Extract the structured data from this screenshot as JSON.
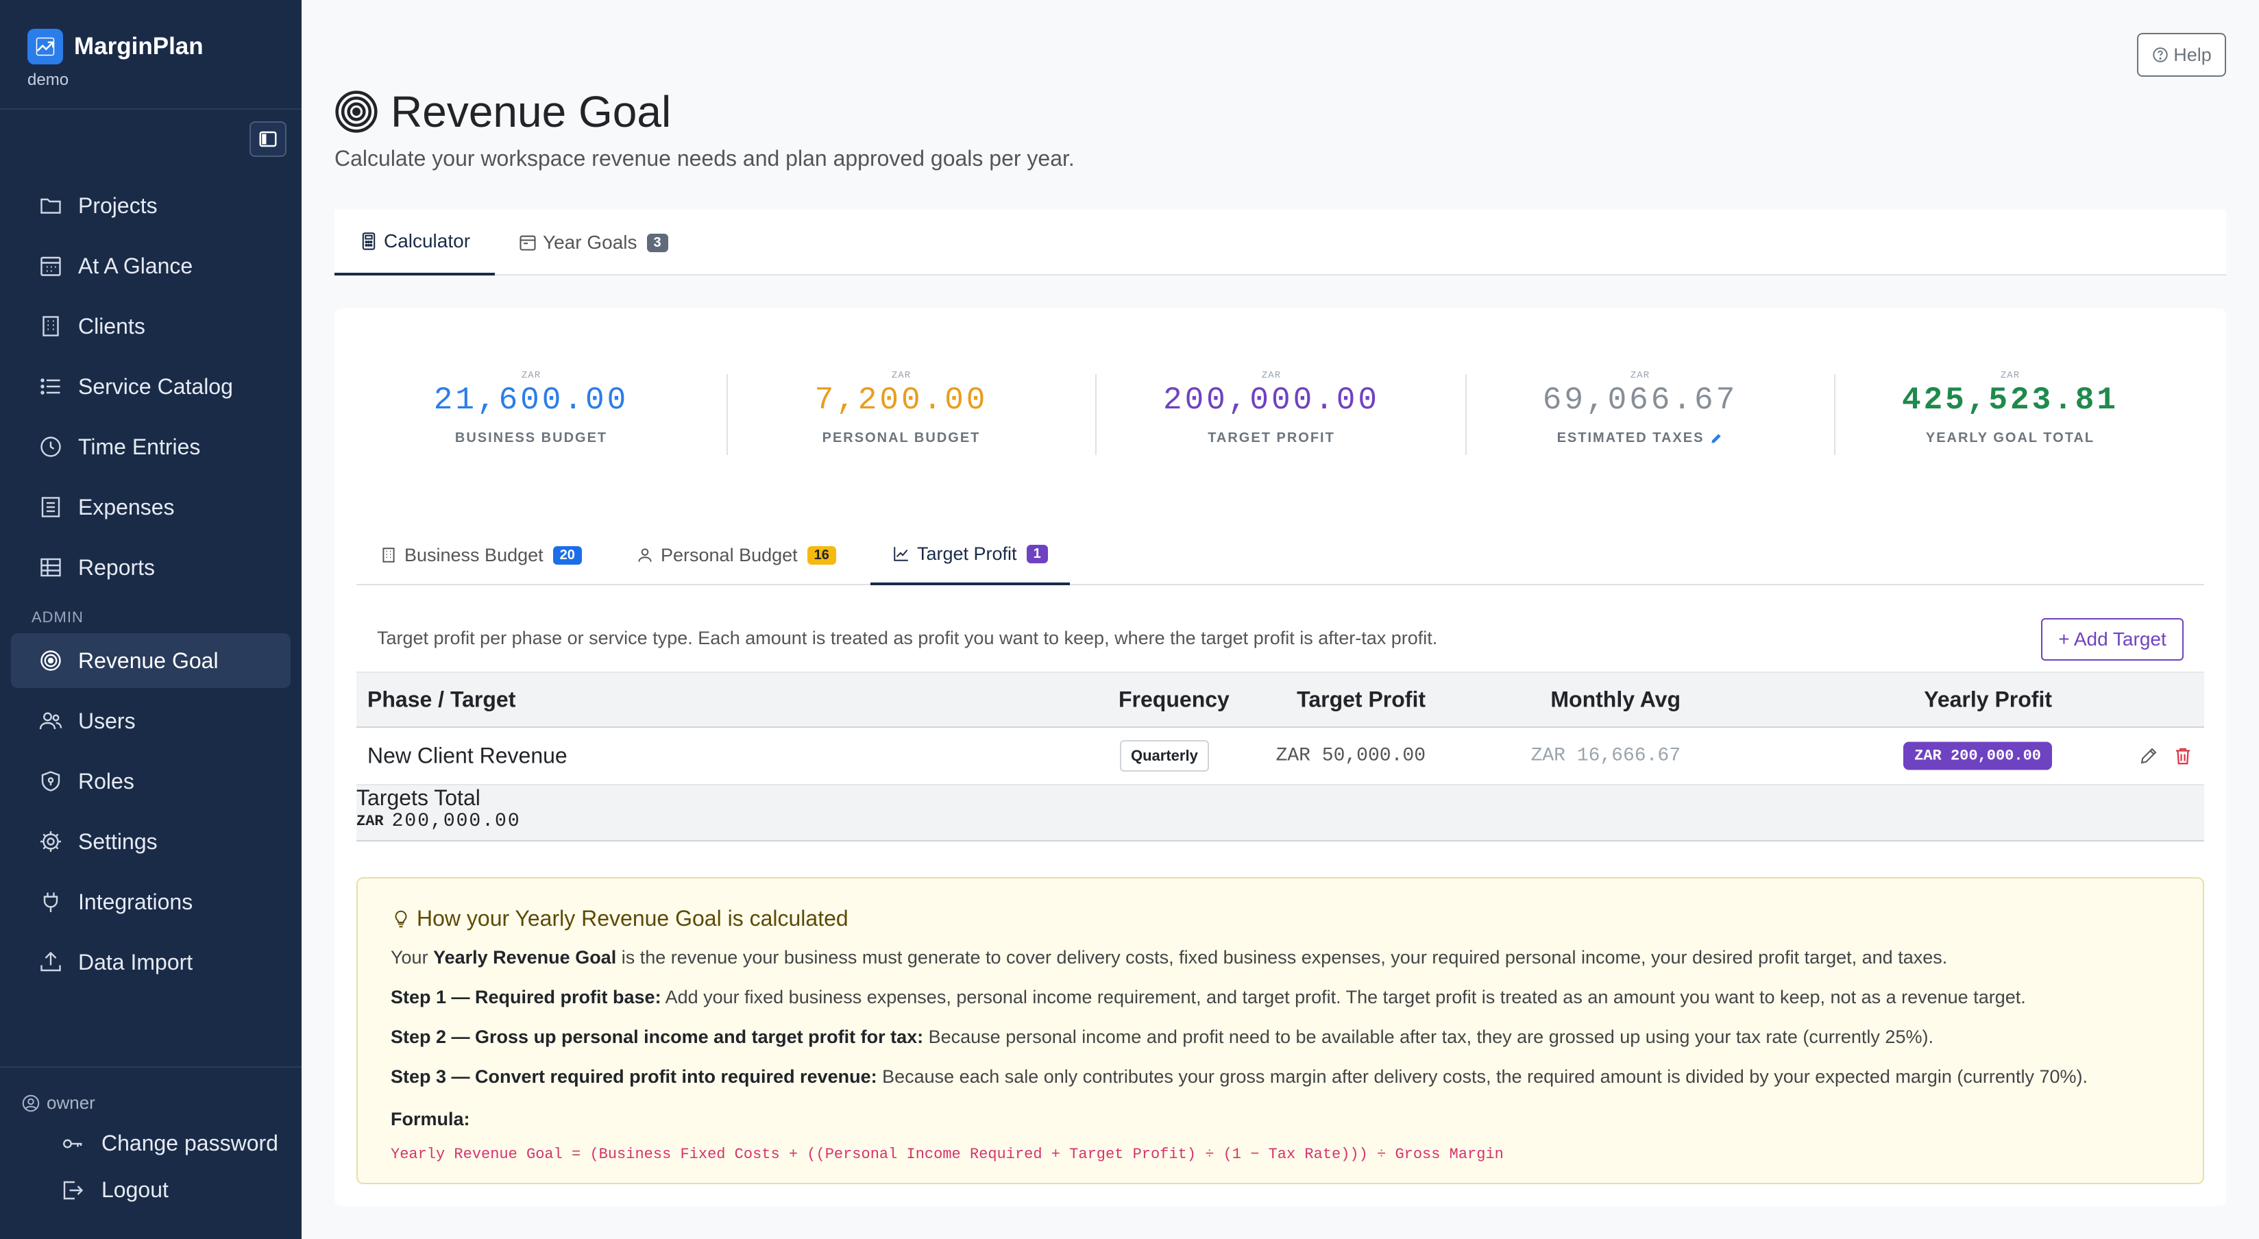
{
  "app": {
    "name": "MarginPlan",
    "workspace": "demo"
  },
  "colors": {
    "sidebar_bg": "#1a2b48",
    "accent_blue": "#2b7de9",
    "purple": "#6f42c1",
    "orange": "#e89d1c",
    "green": "#1e8a4c"
  },
  "sidebar": {
    "items": [
      {
        "label": "Projects",
        "icon": "folder-icon"
      },
      {
        "label": "At A Glance",
        "icon": "calendar-icon"
      },
      {
        "label": "Clients",
        "icon": "building-icon"
      },
      {
        "label": "Service Catalog",
        "icon": "list-icon"
      },
      {
        "label": "Time Entries",
        "icon": "clock-icon"
      },
      {
        "label": "Expenses",
        "icon": "receipt-icon"
      },
      {
        "label": "Reports",
        "icon": "table-icon"
      }
    ],
    "admin_label": "ADMIN",
    "admin_items": [
      {
        "label": "Revenue Goal",
        "icon": "target-icon",
        "active": true
      },
      {
        "label": "Users",
        "icon": "users-icon"
      },
      {
        "label": "Roles",
        "icon": "shield-icon"
      },
      {
        "label": "Settings",
        "icon": "gear-icon"
      },
      {
        "label": "Integrations",
        "icon": "plug-icon"
      },
      {
        "label": "Data Import",
        "icon": "upload-icon"
      }
    ],
    "user_role": "owner",
    "change_password": "Change password",
    "logout": "Logout"
  },
  "header": {
    "help": "Help",
    "title": "Revenue Goal",
    "subtitle": "Calculate your workspace revenue needs and plan approved goals per year."
  },
  "tabs": [
    {
      "label": "Calculator",
      "active": true
    },
    {
      "label": "Year Goals",
      "count": "3"
    }
  ],
  "stats": [
    {
      "currency": "ZAR",
      "value": "21,600.00",
      "label": "BUSINESS BUDGET",
      "color": "#2b7de9"
    },
    {
      "currency": "ZAR",
      "value": "7,200.00",
      "label": "PERSONAL BUDGET",
      "color": "#e89d1c"
    },
    {
      "currency": "ZAR",
      "value": "200,000.00",
      "label": "TARGET PROFIT",
      "color": "#6f42c1"
    },
    {
      "currency": "ZAR",
      "value": "69,066.67",
      "label": "ESTIMATED TAXES",
      "color": "#868e96"
    },
    {
      "currency": "ZAR",
      "value": "425,523.81",
      "label": "YEARLY GOAL TOTAL",
      "color": "#1e8a4c"
    }
  ],
  "subtabs": [
    {
      "label": "Business Budget",
      "count": "20"
    },
    {
      "label": "Personal Budget",
      "count": "16"
    },
    {
      "label": "Target Profit",
      "count": "1",
      "active": true
    }
  ],
  "target_profit": {
    "description": "Target profit per phase or service type. Each amount is treated as profit you want to keep, where the target profit is after-tax profit.",
    "add_button": "+ Add Target",
    "columns": [
      "Phase / Target",
      "Target Profit",
      "Frequency",
      "Monthly Avg",
      "Yearly Profit"
    ],
    "rows": [
      {
        "name": "New Client Revenue",
        "target": "ZAR 50,000.00",
        "frequency": "Quarterly",
        "monthly": "ZAR 16,666.67",
        "yearly": "ZAR 200,000.00"
      }
    ],
    "total_label": "Targets Total",
    "total_currency": "ZAR",
    "total_value": "200,000.00"
  },
  "info": {
    "title": "How your Yearly Revenue Goal is calculated",
    "intro_prefix": "Your ",
    "intro_bold": "Yearly Revenue Goal",
    "intro_rest": " is the revenue your business must generate to cover delivery costs, fixed business expenses, your required personal income, your desired profit target, and taxes.",
    "steps": [
      {
        "bold": "Step 1 — Required profit base:",
        "text": " Add your fixed business expenses, personal income requirement, and target profit. The target profit is treated as an amount you want to keep, not as a revenue target."
      },
      {
        "bold": "Step 2 — Gross up personal income and target profit for tax:",
        "text": " Because personal income and profit need to be available after tax, they are grossed up using your tax rate (currently 25%)."
      },
      {
        "bold": "Step 3 — Convert required profit into required revenue:",
        "text": " Because each sale only contributes your gross margin after delivery costs, the required amount is divided by your expected margin (currently 70%)."
      }
    ],
    "formula_label": "Formula:",
    "formula": "Yearly Revenue Goal = (Business Fixed Costs + ((Personal Income Required + Target Profit) ÷ (1 − Tax Rate))) ÷ Gross Margin"
  }
}
